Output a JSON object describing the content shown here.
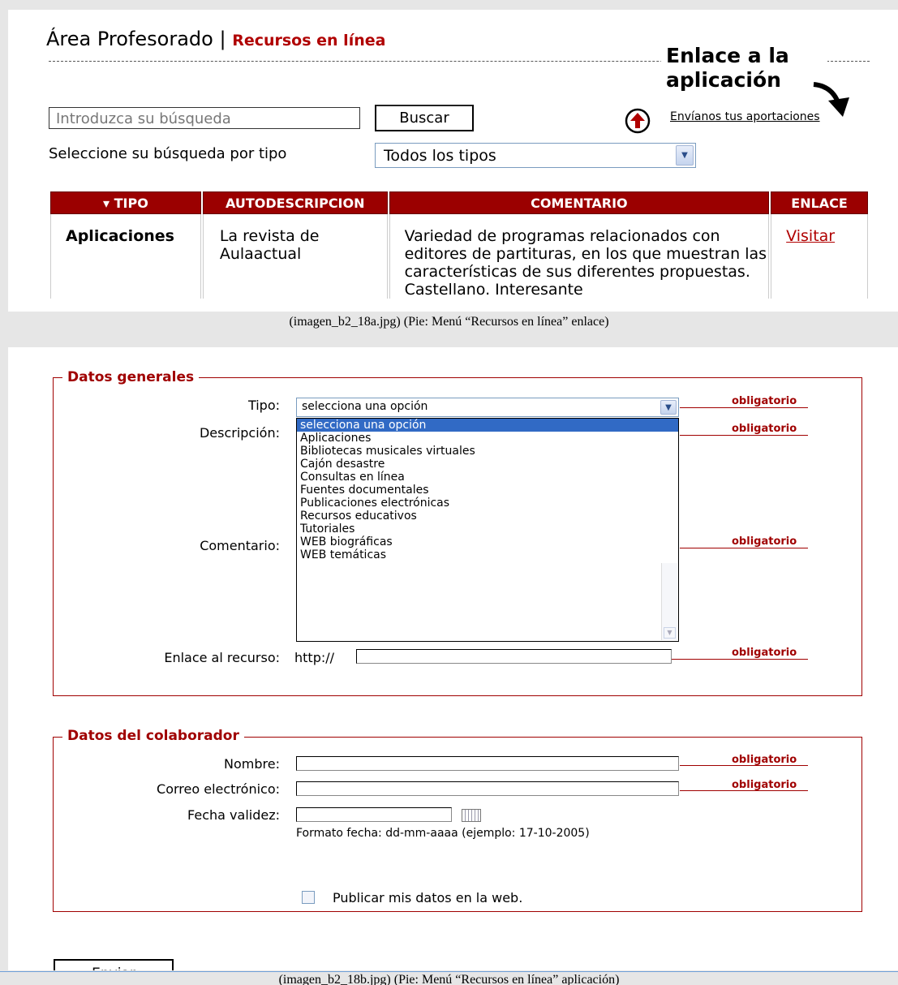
{
  "screen1": {
    "title_main": "Área Profesorado |",
    "title_sub": "Recursos en línea",
    "annotation": "Enlace a la aplicación",
    "search_placeholder": "Introduzca su búsqueda",
    "search_button": "Buscar",
    "contribute_link": "Envíanos tus aportaciones",
    "type_label": "Seleccione su búsqueda por tipo",
    "type_selected": "Todos los tipos",
    "table": {
      "headers": [
        "▾ TIPO",
        "AUTODESCRIPCION",
        "COMENTARIO",
        "ENLACE"
      ],
      "row": {
        "tipo": "Aplicaciones",
        "autodescripcion": "La revista de Aulaactual",
        "comentario": "Variedad de programas relacionados con editores de partituras, en los que muestran las características de sus diferentes propuestas. Castellano. Interesante",
        "enlace": "Visitar"
      }
    }
  },
  "caption1": "(imagen_b2_18a.jpg) (Pie: Menú “Recursos en línea” enlace)",
  "screen2": {
    "general": {
      "legend": "Datos generales",
      "tipo_label": "Tipo:",
      "tipo_value": "selecciona una opción",
      "descripcion_label": "Descripción:",
      "comentario_label": "Comentario:",
      "enlace_label": "Enlace al recurso:",
      "enlace_prefix": "http://",
      "options": [
        "selecciona una opción",
        "Aplicaciones",
        "Bibliotecas musicales virtuales",
        "Cajón desastre",
        "Consultas en línea",
        "Fuentes documentales",
        "Publicaciones electrónicas",
        "Recursos educativos",
        "Tutoriales",
        "WEB biográficas",
        "WEB temáticas"
      ]
    },
    "colaborador": {
      "legend": "Datos del colaborador",
      "nombre_label": "Nombre:",
      "correo_label": "Correo electrónico:",
      "fecha_label": "Fecha validez:",
      "fecha_hint": "Formato fecha: dd-mm-aaaa (ejemplo: 17-10-2005)",
      "publicar_label": "Publicar mis datos en la web."
    },
    "required_text": "obligatorio",
    "submit_button": "Enviar"
  },
  "caption2": "(imagen_b2_18b.jpg) (Pie: Menú “Recursos en línea” aplicación)"
}
